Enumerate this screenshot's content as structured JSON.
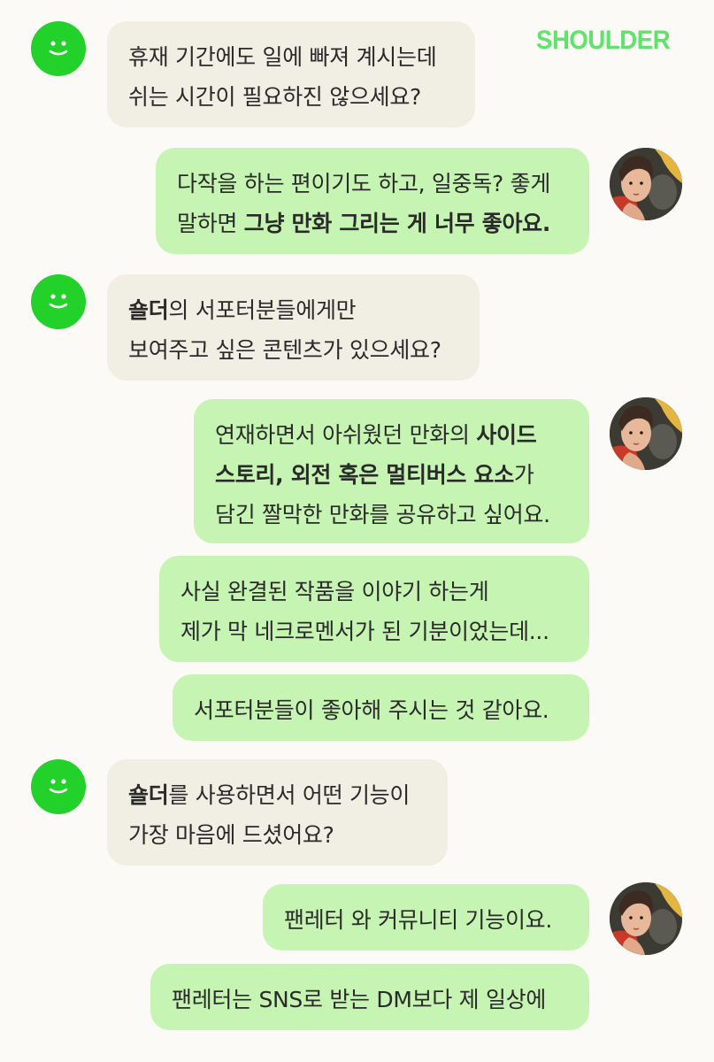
{
  "brand": {
    "logo_text": "SHOULDER",
    "logo_color": "#5fe36a"
  },
  "colors": {
    "page_background": "#fbfaf6",
    "bot_bubble": "#f1eee3",
    "user_bubble": "#c6f4b2",
    "bot_avatar": "#22d12a"
  },
  "icons": {
    "bot_avatar": "smiley-face-icon",
    "user_avatar": "illustrated-portrait-avatar"
  },
  "messages": [
    {
      "sender": "bot",
      "lines": [
        [
          {
            "text": "휴재 기간에도 일에 빠져 계시는데",
            "bold": false
          }
        ],
        [
          {
            "text": "쉬는 시간이 필요하진 않으세요?",
            "bold": false
          }
        ]
      ]
    },
    {
      "sender": "user",
      "lines": [
        [
          {
            "text": "다작을 하는 편이기도 하고, 일중독? 좋게",
            "bold": false
          }
        ],
        [
          {
            "text": "말하면 ",
            "bold": false
          },
          {
            "text": "그냥 만화 그리는 게 너무 좋아요.",
            "bold": true
          }
        ]
      ]
    },
    {
      "sender": "bot",
      "lines": [
        [
          {
            "text": "숄더",
            "bold": true
          },
          {
            "text": "의 서포터분들에게만",
            "bold": false
          }
        ],
        [
          {
            "text": "보여주고 싶은 콘텐츠가 있으세요?",
            "bold": false
          }
        ]
      ]
    },
    {
      "sender": "user",
      "lines": [
        [
          {
            "text": "연재하면서 아쉬웠던 만화의 ",
            "bold": false
          },
          {
            "text": "사이드",
            "bold": true
          }
        ],
        [
          {
            "text": "스토리, 외전  혹은 멀티버스 요소",
            "bold": true
          },
          {
            "text": "가",
            "bold": false
          }
        ],
        [
          {
            "text": "담긴 짤막한 만화를 공유하고 싶어요.",
            "bold": false
          }
        ]
      ]
    },
    {
      "sender": "user",
      "lines": [
        [
          {
            "text": "사실 완결된 작품을 이야기 하는게",
            "bold": false
          }
        ],
        [
          {
            "text": "제가 막 네크로멘서가 된 기분이었는데...",
            "bold": false
          }
        ]
      ]
    },
    {
      "sender": "user",
      "lines": [
        [
          {
            "text": "서포터분들이 좋아해 주시는 것 같아요.",
            "bold": false
          }
        ]
      ]
    },
    {
      "sender": "bot",
      "lines": [
        [
          {
            "text": "숄더",
            "bold": true
          },
          {
            "text": "를 사용하면서 어떤 기능이",
            "bold": false
          }
        ],
        [
          {
            "text": "가장 마음에 드셨어요?",
            "bold": false
          }
        ]
      ]
    },
    {
      "sender": "user",
      "lines": [
        [
          {
            "text": "팬레터 와 커뮤니티 기능이요.",
            "bold": false
          }
        ]
      ]
    },
    {
      "sender": "user",
      "lines": [
        [
          {
            "text": "팬레터는 SNS로 받는 DM보다 제 일상에",
            "bold": false
          }
        ]
      ]
    }
  ]
}
